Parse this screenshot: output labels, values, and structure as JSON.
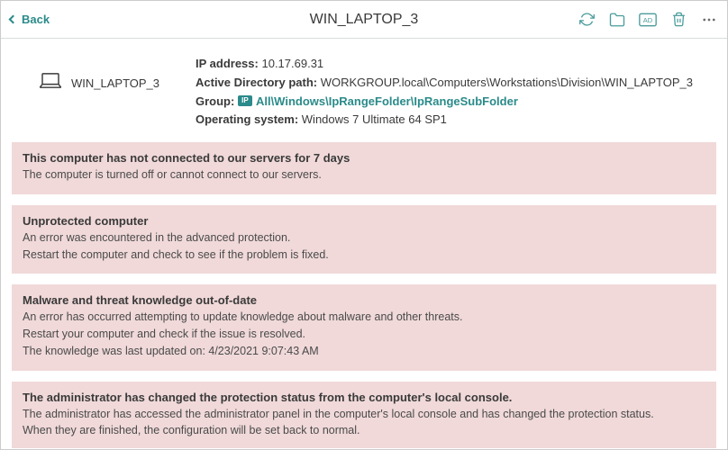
{
  "header": {
    "back_label": "Back",
    "title": "WIN_LAPTOP_3"
  },
  "device": {
    "name": "WIN_LAPTOP_3",
    "ip_label": "IP address:",
    "ip_value": "10.17.69.31",
    "ad_label": "Active Directory path:",
    "ad_value": "WORKGROUP.local\\Computers\\Workstations\\Division\\WIN_LAPTOP_3",
    "group_label": "Group:",
    "group_badge": "IP",
    "group_value": "All\\Windows\\IpRangeFolder\\IpRangeSubFolder",
    "os_label": "Operating system:",
    "os_value": "Windows 7 Ultimate 64 SP1"
  },
  "alerts": [
    {
      "title": "This computer has not connected to our servers for 7 days",
      "body": "The computer is turned off or cannot connect to our servers."
    },
    {
      "title": "Unprotected computer",
      "body": "An error was encountered in the advanced protection.\nRestart the computer and check to see if the problem is fixed."
    },
    {
      "title": "Malware and threat knowledge out-of-date",
      "body": "An error has occurred attempting to update knowledge about malware and other threats.\nRestart your computer and check if the issue is resolved.\nThe knowledge was last updated on: 4/23/2021 9:07:43 AM"
    },
    {
      "title": "The administrator has changed the protection status from the computer's local console.",
      "body": "The administrator has accessed the administrator panel in the computer's local console and has changed the protection status.\nWhen they are finished, the configuration will be set back to normal."
    }
  ]
}
